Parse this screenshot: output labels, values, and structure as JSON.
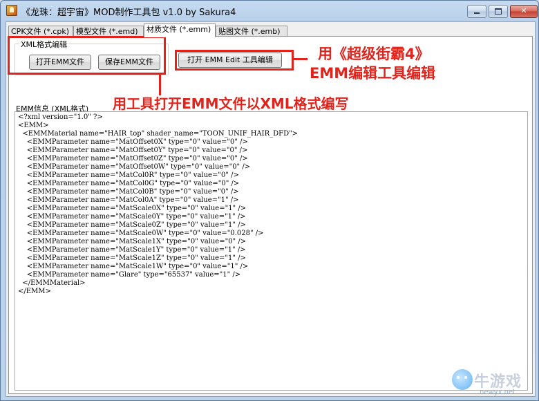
{
  "window": {
    "title": "《龙珠：超宇宙》MOD制作工具包 v1.0 by Sakura4"
  },
  "tabs": [
    {
      "label": "CPK文件 (*.cpk)",
      "active": false
    },
    {
      "label": "模型文件 (*.emd)",
      "active": false
    },
    {
      "label": "材质文件 (*.emm)",
      "active": true
    },
    {
      "label": "贴图文件 (*.emb)",
      "active": false
    }
  ],
  "xml_group": {
    "legend": "XML格式编辑",
    "open_button": "打开EMM文件",
    "save_button": "保存EMM文件"
  },
  "emm_edit_button": "打开 EMM Edit 工具编辑",
  "xml_info_label": "EMM信息 (XML格式)",
  "annotations": {
    "right_line1": "用《超级街霸4》",
    "right_line2": "EMM编辑工具编辑",
    "middle": "用工具打开EMM文件以XML格式编写"
  },
  "xml_lines": [
    "<?xml version=\"1.0\" ?>",
    "<EMM>",
    "  <EMMMaterial name=\"HAIR_top\" shader_name=\"TOON_UNIF_HAIR_DFD\">",
    "    <EMMParameter name=\"MatOffset0X\" type=\"0\" value=\"0\" />",
    "    <EMMParameter name=\"MatOffset0Y\" type=\"0\" value=\"0\" />",
    "    <EMMParameter name=\"MatOffset0Z\" type=\"0\" value=\"0\" />",
    "    <EMMParameter name=\"MatOffset0W\" type=\"0\" value=\"0\" />",
    "    <EMMParameter name=\"MatCol0R\" type=\"0\" value=\"0\" />",
    "    <EMMParameter name=\"MatCol0G\" type=\"0\" value=\"0\" />",
    "    <EMMParameter name=\"MatCol0B\" type=\"0\" value=\"0\" />",
    "    <EMMParameter name=\"MatCol0A\" type=\"0\" value=\"1\" />",
    "    <EMMParameter name=\"MatScale0X\" type=\"0\" value=\"1\" />",
    "    <EMMParameter name=\"MatScale0Y\" type=\"0\" value=\"1\" />",
    "    <EMMParameter name=\"MatScale0Z\" type=\"0\" value=\"1\" />",
    "    <EMMParameter name=\"MatScale0W\" type=\"0\" value=\"0.028\" />",
    "    <EMMParameter name=\"MatScale1X\" type=\"0\" value=\"0\" />",
    "    <EMMParameter name=\"MatScale1Y\" type=\"0\" value=\"1\" />",
    "    <EMMParameter name=\"MatScale1Z\" type=\"0\" value=\"1\" />",
    "    <EMMParameter name=\"MatScale1W\" type=\"0\" value=\"1\" />",
    "    <EMMParameter name=\"Glare\" type=\"65537\" value=\"1\" />",
    "  </EMMMaterial>",
    "</EMM>"
  ],
  "watermark": {
    "text": "牛游戏",
    "url": "newyx.net"
  },
  "colors": {
    "annotation_red": "#e0241c",
    "titlebar_blue": "#c6dbf1"
  }
}
